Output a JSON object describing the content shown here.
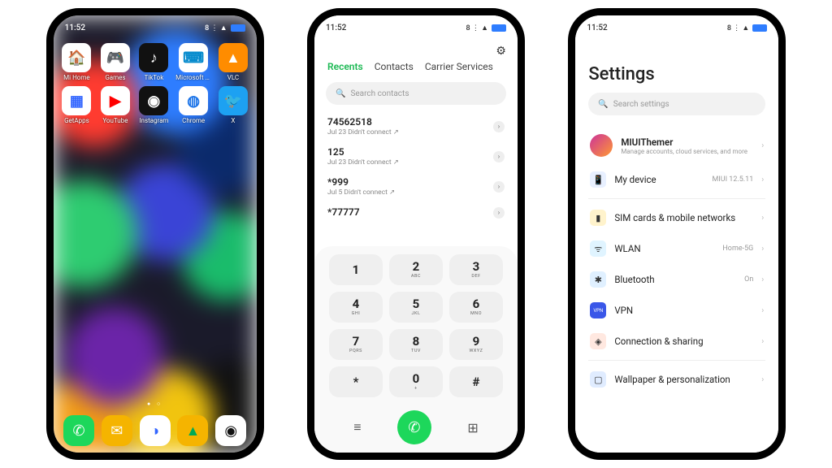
{
  "status": {
    "time": "11:52",
    "signal": "8 ⋮ ▲"
  },
  "home": {
    "apps": [
      {
        "name": "Mi Home",
        "bg": "#ffffff",
        "glyph": "🏠",
        "fg": "#5aa"
      },
      {
        "name": "Games",
        "bg": "#ffffff",
        "glyph": "🎮",
        "fg": "#36f"
      },
      {
        "name": "TikTok",
        "bg": "#111111",
        "glyph": "♪",
        "fg": "#fff"
      },
      {
        "name": "Microsoft SwiftKey ...",
        "bg": "#ffffff",
        "glyph": "⌨",
        "fg": "#08c"
      },
      {
        "name": "VLC",
        "bg": "#ff8c00",
        "glyph": "▲",
        "fg": "#fff"
      },
      {
        "name": "GetApps",
        "bg": "#ffffff",
        "glyph": "▦",
        "fg": "#36f"
      },
      {
        "name": "YouTube",
        "bg": "#ffffff",
        "glyph": "▶",
        "fg": "#f00"
      },
      {
        "name": "Instagram",
        "bg": "#111111",
        "glyph": "◉",
        "fg": "#fff"
      },
      {
        "name": "Chrome",
        "bg": "#ffffff",
        "glyph": "◍",
        "fg": "#1a73e8"
      },
      {
        "name": "X",
        "bg": "#1da1f2",
        "glyph": "🐦",
        "fg": "#fff"
      }
    ],
    "dock": [
      {
        "name": "phone",
        "bg": "#1dd75b",
        "glyph": "✆",
        "fg": "#fff"
      },
      {
        "name": "messages",
        "bg": "#f5b400",
        "glyph": "✉",
        "fg": "#fff"
      },
      {
        "name": "browser",
        "bg": "#ffffff",
        "glyph": "◑",
        "fg": "#36f"
      },
      {
        "name": "gallery",
        "bg": "#f5b400",
        "glyph": "▲",
        "fg": "#0a5"
      },
      {
        "name": "camera",
        "bg": "#ffffff",
        "glyph": "◉",
        "fg": "#111"
      }
    ]
  },
  "dialer": {
    "tabs": [
      "Recents",
      "Contacts",
      "Carrier Services"
    ],
    "active_tab": 0,
    "search_placeholder": "Search contacts",
    "calls": [
      {
        "number": "74562518",
        "meta": "Jul 23 Didn't connect ↗"
      },
      {
        "number": "125",
        "meta": "Jul 23 Didn't connect ↗"
      },
      {
        "number": "*999",
        "meta": "Jul 5 Didn't connect ↗"
      },
      {
        "number": "*77777",
        "meta": ""
      }
    ],
    "keys": [
      {
        "d": "1",
        "s": ""
      },
      {
        "d": "2",
        "s": "ABC"
      },
      {
        "d": "3",
        "s": "DEF"
      },
      {
        "d": "4",
        "s": "GHI"
      },
      {
        "d": "5",
        "s": "JKL"
      },
      {
        "d": "6",
        "s": "MNO"
      },
      {
        "d": "7",
        "s": "PQRS"
      },
      {
        "d": "8",
        "s": "TUV"
      },
      {
        "d": "9",
        "s": "WXYZ"
      },
      {
        "d": "*",
        "s": ""
      },
      {
        "d": "0",
        "s": "+"
      },
      {
        "d": "#",
        "s": ""
      }
    ]
  },
  "settings": {
    "title": "Settings",
    "search_placeholder": "Search settings",
    "account": {
      "name": "MIUIThemer",
      "sub": "Manage accounts, cloud services, and more"
    },
    "rows": [
      {
        "icon": "📱",
        "ibg": "#e8f0ff",
        "label": "My device",
        "val": "MIUI 12.5.11"
      },
      {
        "divider": true
      },
      {
        "icon": "▮",
        "ibg": "#fff3cc",
        "label": "SIM cards & mobile networks",
        "val": ""
      },
      {
        "icon": "ᯤ",
        "ibg": "#e0f4ff",
        "label": "WLAN",
        "val": "Home-5G"
      },
      {
        "icon": "✱",
        "ibg": "#e0f0ff",
        "label": "Bluetooth",
        "val": "On"
      },
      {
        "icon": "VPN",
        "ibg": "#3a57e8",
        "label": "VPN",
        "val": "",
        "small": true
      },
      {
        "icon": "◈",
        "ibg": "#ffe8e0",
        "label": "Connection & sharing",
        "val": ""
      },
      {
        "divider": true
      },
      {
        "icon": "▢",
        "ibg": "#e0ecff",
        "label": "Wallpaper & personalization",
        "val": ""
      }
    ]
  }
}
